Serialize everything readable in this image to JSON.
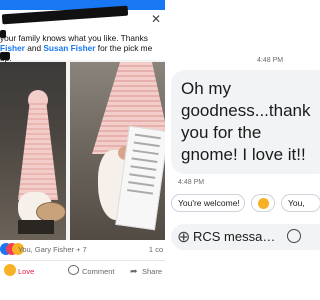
{
  "facebook_post": {
    "text_parts": {
      "line_a": "your family knows what you like. Thanks",
      "name1": "Fisher",
      "and": " and ",
      "name2": "Susan Fisher",
      "line_b": " for the pick me up."
    },
    "reaction_text": "You, Gary Fisher + 7",
    "comments": "1 co",
    "actions": {
      "like": "Love",
      "comment": "Comment",
      "share": "Share"
    },
    "colors": {
      "brand": "#1877f2",
      "love": "#e41e3f"
    }
  },
  "messages": {
    "timestamp_top": "4:48 PM",
    "bubble": "Oh my goodness...thank you for the gnome! I love it!!",
    "timestamp_msg": "4:48 PM",
    "suggested_replies": [
      "You're welcome!",
      "😊",
      "You,"
    ],
    "compose_placeholder": "RCS messa…"
  }
}
